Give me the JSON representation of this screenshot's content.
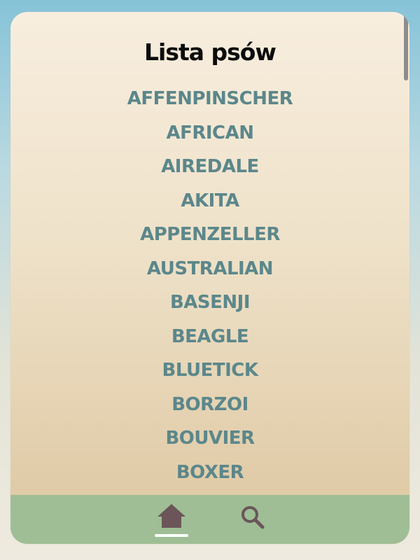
{
  "header": {
    "title": "Lista psów"
  },
  "breeds": [
    "AFFENPINSCHER",
    "AFRICAN",
    "AIREDALE",
    "AKITA",
    "APPENZELLER",
    "AUSTRALIAN",
    "BASENJI",
    "BEAGLE",
    "BLUETICK",
    "BORZOI",
    "BOUVIER",
    "BOXER"
  ],
  "nav": {
    "items": [
      {
        "icon": "home-icon",
        "active": true
      },
      {
        "icon": "search-icon",
        "active": false
      }
    ]
  },
  "colors": {
    "background_top": "#86c3d8",
    "card_top": "#f8eedf",
    "card_bottom": "#e0cba7",
    "breed_text": "#5b878b",
    "title_text": "#0c0c0c",
    "nav_background": "#9fbe95",
    "nav_icon": "#6b5559",
    "nav_active_indicator": "#ffffff"
  }
}
